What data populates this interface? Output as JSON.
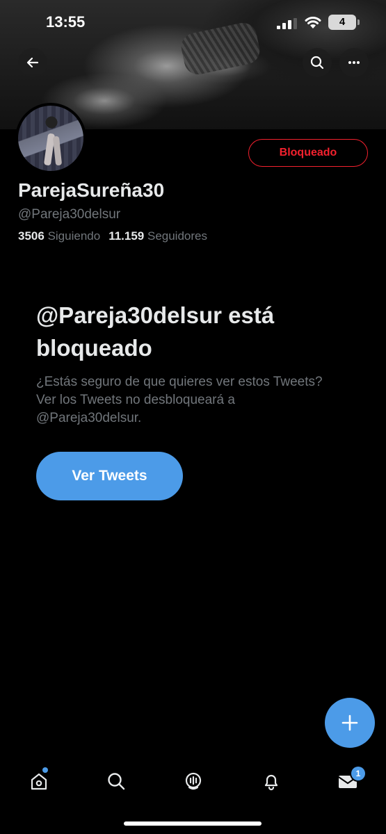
{
  "status_bar": {
    "time": "13:55",
    "battery": "4"
  },
  "profile": {
    "display_name": "ParejaSureña30",
    "handle": "@Pareja30delsur",
    "following_count": "3506",
    "following_label": "Siguiendo",
    "followers_count": "11.159",
    "followers_label": "Seguidores",
    "blocked_button_label": "Bloqueado"
  },
  "blocked_notice": {
    "title": "@Pareja30delsur está bloqueado",
    "description": "¿Estás seguro de que quieres ver estos Tweets? Ver los Tweets no desbloqueará a @Pareja30delsur.",
    "view_button_label": "Ver Tweets"
  },
  "tab_bar": {
    "items": [
      "home",
      "search",
      "spaces",
      "notifications",
      "messages"
    ],
    "messages_badge": "1"
  },
  "colors": {
    "background": "#000000",
    "accent": "#4c9be8",
    "blocked": "#f4212e",
    "primary_text": "#e7e9ea",
    "secondary_text": "#71767b"
  },
  "icons": {
    "back": "arrow-left-icon",
    "search": "search-icon",
    "more": "more-horizontal-icon",
    "fab": "plus-icon",
    "tabs": [
      "home-icon",
      "search-icon",
      "spaces-icon",
      "bell-icon",
      "mail-icon"
    ]
  }
}
